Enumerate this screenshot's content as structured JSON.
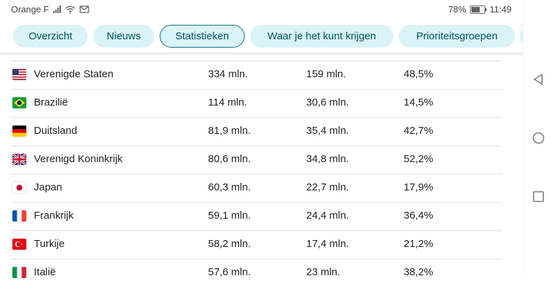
{
  "status_bar": {
    "carrier": "Orange F",
    "battery": "78%",
    "battery_level": 0.78,
    "time": "11:49",
    "icons": [
      "signal-icon",
      "wifi-icon",
      "mail-icon",
      "battery-icon"
    ]
  },
  "tabs": [
    {
      "label": "Overzicht",
      "active": false
    },
    {
      "label": "Nieuws",
      "active": false
    },
    {
      "label": "Statistieken",
      "active": true
    },
    {
      "label": "Waar je het kunt krijgen",
      "active": false
    },
    {
      "label": "Prioriteitsgroepen",
      "active": false
    }
  ],
  "rows": [
    {
      "flag": "us",
      "country": "Verenigde Staten",
      "population": "334 mln.",
      "vaccinated": "159 mln.",
      "percent": "48,5%"
    },
    {
      "flag": "br",
      "country": "Brazilië",
      "population": "114 mln.",
      "vaccinated": "30,6 mln.",
      "percent": "14,5%"
    },
    {
      "flag": "de",
      "country": "Duitsland",
      "population": "81,9 mln.",
      "vaccinated": "35,4 mln.",
      "percent": "42,7%"
    },
    {
      "flag": "gb",
      "country": "Verenigd Koninkrijk",
      "population": "80,6 mln.",
      "vaccinated": "34,8 mln.",
      "percent": "52,2%"
    },
    {
      "flag": "jp",
      "country": "Japan",
      "population": "60,3 mln.",
      "vaccinated": "22,7 mln.",
      "percent": "17,9%"
    },
    {
      "flag": "fr",
      "country": "Frankrijk",
      "population": "59,1 mln.",
      "vaccinated": "24,4 mln.",
      "percent": "36,4%"
    },
    {
      "flag": "tr",
      "country": "Turkije",
      "population": "58,2 mln.",
      "vaccinated": "17,4 mln.",
      "percent": "21,2%"
    },
    {
      "flag": "it",
      "country": "Italië",
      "population": "57,6 mln.",
      "vaccinated": "23 mln.",
      "percent": "38,2%"
    }
  ],
  "colors": {
    "chip_bg": "#d9f3f7",
    "chip_text": "#01535f",
    "chip_active_border": "#0b6f7d"
  }
}
